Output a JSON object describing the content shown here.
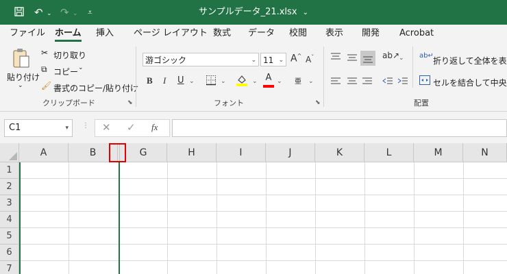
{
  "window": {
    "title": "サンプルデータ_21.xlsx",
    "title_caret": "⌄"
  },
  "quick_access": {
    "save_icon": "save-icon",
    "undo_icon": "undo-icon",
    "redo_icon": "redo-icon",
    "customize_icon": "customize-icon"
  },
  "menu": {
    "tabs": [
      "ファイル",
      "ホーム",
      "挿入",
      "ページ レイアウト",
      "数式",
      "データ",
      "校閲",
      "表示",
      "開発",
      "Acrobat"
    ],
    "active": "ホーム"
  },
  "ribbon": {
    "clipboard": {
      "paste_label": "貼り付け",
      "cut_label": "切り取り",
      "copy_label": "コピー",
      "format_painter_label": "書式のコピー/貼り付け",
      "group_label": "クリップボード"
    },
    "font": {
      "font_name": "游ゴシック",
      "font_size": "11",
      "bold": "B",
      "italic": "I",
      "underline": "U",
      "font_color_letter": "A",
      "highlight_color": "#ffff00",
      "font_color": "#ff0000",
      "group_label": "フォント"
    },
    "alignment": {
      "wrap_text_label": "折り返して全体を表示する",
      "merge_label": "セルを結合して中央揃え",
      "group_label": "配置"
    }
  },
  "formula_bar": {
    "name_box": "C1",
    "fx": "fx",
    "value": ""
  },
  "grid": {
    "columns": [
      "A",
      "B",
      "G",
      "H",
      "I",
      "J",
      "K",
      "L",
      "M",
      "N"
    ],
    "rows": [
      "1",
      "2",
      "3",
      "4",
      "5",
      "6",
      "7"
    ],
    "accent": "#217346",
    "highlight_border": "#e00000"
  }
}
